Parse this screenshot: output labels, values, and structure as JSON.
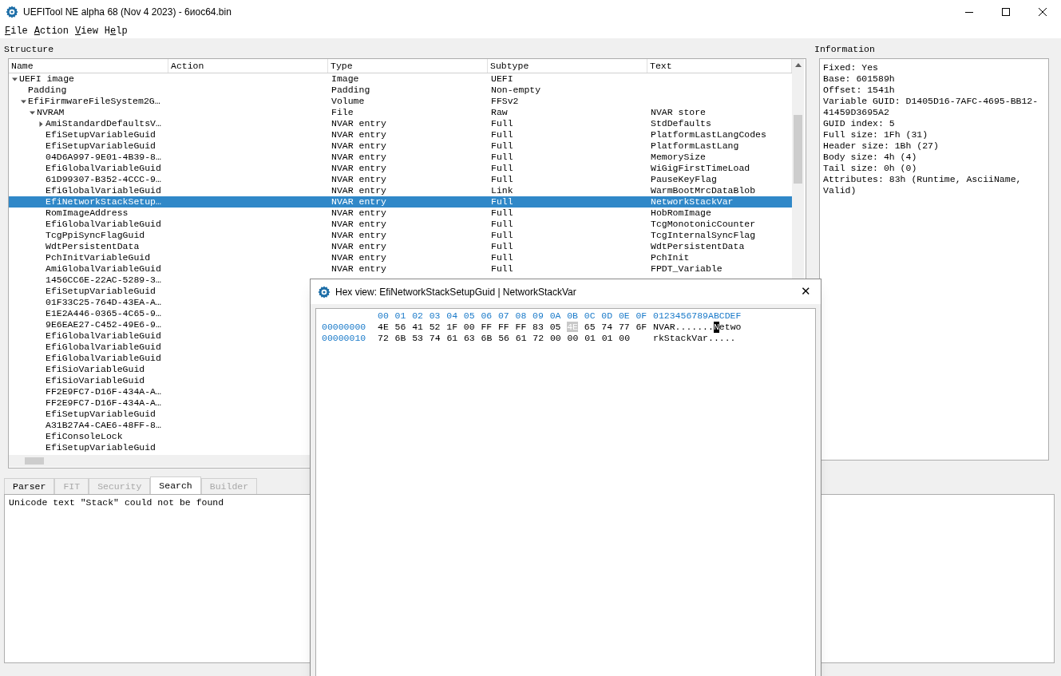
{
  "window": {
    "title": "UEFITool NE alpha 68 (Nov  4 2023) - 6иос64.bin"
  },
  "menu": [
    {
      "accel": "F",
      "rest": "ile"
    },
    {
      "accel": "A",
      "rest": "ction"
    },
    {
      "accel": "V",
      "rest": "iew"
    },
    {
      "before": "H",
      "accel": "e",
      "rest": "lp"
    }
  ],
  "structure": {
    "title": "Structure",
    "columns": [
      "Name",
      "Action",
      "Type",
      "Subtype",
      "Text"
    ],
    "tree": [
      {
        "name": "UEFI image",
        "type": "Image",
        "subtype": "UEFI",
        "expanded": true,
        "selected": false,
        "children": [
          {
            "name": "Padding",
            "type": "Padding",
            "subtype": "Non-empty",
            "selected": false
          },
          {
            "name": "EfiFirmwareFileSystem2G…",
            "type": "Volume",
            "subtype": "FFSv2",
            "expanded": true,
            "selected": false,
            "children": [
              {
                "name": "NVRAM",
                "type": "File",
                "subtype": "Raw",
                "text": "NVAR store",
                "expanded": true,
                "selected": false,
                "children": [
                  {
                    "name": "AmiStandardDefaultsV…",
                    "type": "NVAR entry",
                    "subtype": "Full",
                    "text": "StdDefaults",
                    "expandable": true,
                    "expanded": false,
                    "selected": false
                  },
                  {
                    "name": "EfiSetupVariableGuid",
                    "type": "NVAR entry",
                    "subtype": "Full",
                    "text": "PlatformLastLangCodes",
                    "selected": false
                  },
                  {
                    "name": "EfiSetupVariableGuid",
                    "type": "NVAR entry",
                    "subtype": "Full",
                    "text": "PlatformLastLang",
                    "selected": false
                  },
                  {
                    "name": "04D6A997-9E01-4B39-8…",
                    "type": "NVAR entry",
                    "subtype": "Full",
                    "text": "MemorySize",
                    "selected": false
                  },
                  {
                    "name": "EfiGlobalVariableGuid",
                    "type": "NVAR entry",
                    "subtype": "Full",
                    "text": "WiGigFirstTimeLoad",
                    "selected": false
                  },
                  {
                    "name": "61D99307-B352-4CCC-9…",
                    "type": "NVAR entry",
                    "subtype": "Full",
                    "text": "PauseKeyFlag",
                    "selected": false
                  },
                  {
                    "name": "EfiGlobalVariableGuid",
                    "type": "NVAR entry",
                    "subtype": "Link",
                    "text": "WarmBootMrcDataBlob",
                    "selected": false
                  },
                  {
                    "name": "EfiNetworkStackSetup…",
                    "type": "NVAR entry",
                    "subtype": "Full",
                    "text": "NetworkStackVar",
                    "selected": true
                  },
                  {
                    "name": "RomImageAddress",
                    "type": "NVAR entry",
                    "subtype": "Full",
                    "text": "HobRomImage",
                    "selected": false
                  },
                  {
                    "name": "EfiGlobalVariableGuid",
                    "type": "NVAR entry",
                    "subtype": "Full",
                    "text": "TcgMonotonicCounter",
                    "selected": false
                  },
                  {
                    "name": "TcgPpiSyncFlagGuid",
                    "type": "NVAR entry",
                    "subtype": "Full",
                    "text": "TcgInternalSyncFlag",
                    "selected": false
                  },
                  {
                    "name": "WdtPersistentData",
                    "type": "NVAR entry",
                    "subtype": "Full",
                    "text": "WdtPersistentData",
                    "selected": false
                  },
                  {
                    "name": "PchInitVariableGuid",
                    "type": "NVAR entry",
                    "subtype": "Full",
                    "text": "PchInit",
                    "selected": false
                  },
                  {
                    "name": "AmiGlobalVariableGuid",
                    "type": "NVAR entry",
                    "subtype": "Full",
                    "text": "FPDT_Variable",
                    "selected": false
                  },
                  {
                    "name": "1456CC6E-22AC-5289-3…",
                    "selected": false
                  },
                  {
                    "name": "EfiSetupVariableGuid",
                    "selected": false
                  },
                  {
                    "name": "01F33C25-764D-43EA-A…",
                    "selected": false
                  },
                  {
                    "name": "E1E2A446-0365-4C65-9…",
                    "selected": false
                  },
                  {
                    "name": "9E6EAE27-C452-49E6-9…",
                    "selected": false
                  },
                  {
                    "name": "EfiGlobalVariableGuid",
                    "selected": false
                  },
                  {
                    "name": "EfiGlobalVariableGuid",
                    "selected": false
                  },
                  {
                    "name": "EfiGlobalVariableGuid",
                    "selected": false
                  },
                  {
                    "name": "EfiSioVariableGuid",
                    "selected": false
                  },
                  {
                    "name": "EfiSioVariableGuid",
                    "selected": false
                  },
                  {
                    "name": "FF2E9FC7-D16F-434A-A…",
                    "selected": false
                  },
                  {
                    "name": "FF2E9FC7-D16F-434A-A…",
                    "selected": false
                  },
                  {
                    "name": "EfiSetupVariableGuid",
                    "selected": false
                  },
                  {
                    "name": "A31B27A4-CAE6-48FF-8…",
                    "selected": false
                  },
                  {
                    "name": "EfiConsoleLock",
                    "selected": false
                  },
                  {
                    "name": "EfiSetupVariableGuid",
                    "selected": false
                  }
                ]
              }
            ]
          }
        ]
      }
    ]
  },
  "information": {
    "title": "Information",
    "lines": [
      "Fixed: Yes",
      "Base: 601589h",
      "Offset: 1541h",
      "Variable GUID: D1405D16-7AFC-4695-BB12-41459D3695A2",
      "GUID index: 5",
      "Full size: 1Fh (31)",
      "Header size: 1Bh (27)",
      "Body size: 4h (4)",
      "Tail size: 0h (0)",
      "Attributes: 83h (Runtime, AsciiName, Valid)"
    ]
  },
  "tabs": [
    {
      "label": "Parser",
      "selected": false,
      "disabled": false
    },
    {
      "label": "FIT",
      "selected": false,
      "disabled": true
    },
    {
      "label": "Security",
      "selected": false,
      "disabled": true
    },
    {
      "label": "Search",
      "selected": true,
      "disabled": false
    },
    {
      "label": "Builder",
      "selected": false,
      "disabled": true
    }
  ],
  "messages": [
    "Unicode text \"Stack\" could not be found"
  ],
  "hex_dialog": {
    "title": "Hex view: EfiNetworkStackSetupGuid | NetworkStackVar",
    "close": "✕",
    "header_offsets": [
      "00",
      "01",
      "02",
      "03",
      "04",
      "05",
      "06",
      "07",
      "08",
      "09",
      "0A",
      "0B",
      "0C",
      "0D",
      "0E",
      "0F"
    ],
    "header_ascii": "0123456789ABCDEF",
    "rows": [
      {
        "address": "00000000",
        "bytes": [
          {
            "v": "4E",
            "selected": false
          },
          {
            "v": "56",
            "selected": false
          },
          {
            "v": "41",
            "selected": false
          },
          {
            "v": "52",
            "selected": false
          },
          {
            "v": "1F",
            "selected": false
          },
          {
            "v": "00",
            "selected": false
          },
          {
            "v": "FF",
            "selected": false
          },
          {
            "v": "FF",
            "selected": false
          },
          {
            "v": "FF",
            "selected": false
          },
          {
            "v": "83",
            "selected": false
          },
          {
            "v": "05",
            "selected": false
          },
          {
            "v": "4E",
            "selected": true
          },
          {
            "v": "65",
            "selected": false
          },
          {
            "v": "74",
            "selected": false
          },
          {
            "v": "77",
            "selected": false
          },
          {
            "v": "6F",
            "selected": false
          }
        ],
        "ascii_before": "NVAR.......",
        "ascii_cursor": "N",
        "ascii_after": "etwo"
      },
      {
        "address": "00000010",
        "bytes": [
          {
            "v": "72",
            "selected": false
          },
          {
            "v": "6B",
            "selected": false
          },
          {
            "v": "53",
            "selected": false
          },
          {
            "v": "74",
            "selected": false
          },
          {
            "v": "61",
            "selected": false
          },
          {
            "v": "63",
            "selected": false
          },
          {
            "v": "6B",
            "selected": false
          },
          {
            "v": "56",
            "selected": false
          },
          {
            "v": "61",
            "selected": false
          },
          {
            "v": "72",
            "selected": false
          },
          {
            "v": "00",
            "selected": false
          },
          {
            "v": "00",
            "selected": false
          },
          {
            "v": "01",
            "selected": false
          },
          {
            "v": "01",
            "selected": false
          },
          {
            "v": "00",
            "selected": false
          }
        ],
        "ascii_before": "rkStackVar....."
      }
    ]
  }
}
